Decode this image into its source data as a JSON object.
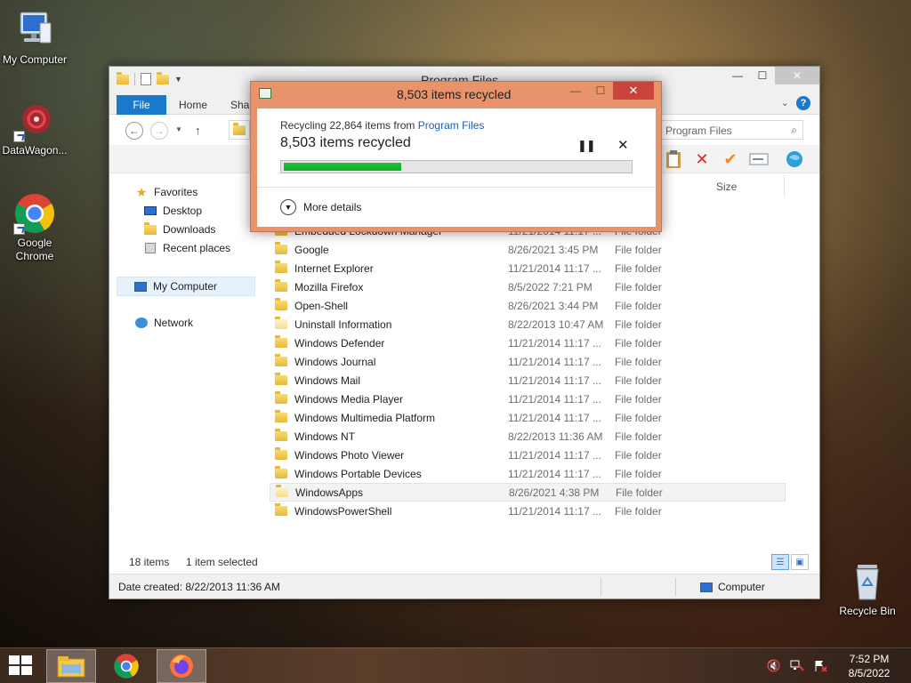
{
  "desktop": {
    "icons": [
      {
        "label": "My Computer"
      },
      {
        "label": "DataWagon..."
      },
      {
        "label": "Google Chrome"
      },
      {
        "label": "Recycle Bin"
      }
    ]
  },
  "explorer": {
    "title": "Program Files",
    "ribbon_tabs": {
      "file": "File",
      "home": "Home",
      "share": "Share"
    },
    "search_placeholder": "Program Files",
    "column_header_size": "Size",
    "nav": {
      "favorites": "Favorites",
      "desktop": "Desktop",
      "downloads": "Downloads",
      "recent": "Recent places",
      "my_computer": "My Computer",
      "network": "Network"
    },
    "files": [
      {
        "name": "Embedded Lockdown Manager",
        "date": "11/21/2014 11:17 ...",
        "type": "File folder"
      },
      {
        "name": "Google",
        "date": "8/26/2021 3:45 PM",
        "type": "File folder"
      },
      {
        "name": "Internet Explorer",
        "date": "11/21/2014 11:17 ...",
        "type": "File folder"
      },
      {
        "name": "Mozilla Firefox",
        "date": "8/5/2022 7:21 PM",
        "type": "File folder"
      },
      {
        "name": "Open-Shell",
        "date": "8/26/2021 3:44 PM",
        "type": "File folder"
      },
      {
        "name": "Uninstall Information",
        "date": "8/22/2013 10:47 AM",
        "type": "File folder"
      },
      {
        "name": "Windows Defender",
        "date": "11/21/2014 11:17 ...",
        "type": "File folder"
      },
      {
        "name": "Windows Journal",
        "date": "11/21/2014 11:17 ...",
        "type": "File folder"
      },
      {
        "name": "Windows Mail",
        "date": "11/21/2014 11:17 ...",
        "type": "File folder"
      },
      {
        "name": "Windows Media Player",
        "date": "11/21/2014 11:17 ...",
        "type": "File folder"
      },
      {
        "name": "Windows Multimedia Platform",
        "date": "11/21/2014 11:17 ...",
        "type": "File folder"
      },
      {
        "name": "Windows NT",
        "date": "8/22/2013 11:36 AM",
        "type": "File folder"
      },
      {
        "name": "Windows Photo Viewer",
        "date": "11/21/2014 11:17 ...",
        "type": "File folder"
      },
      {
        "name": "Windows Portable Devices",
        "date": "11/21/2014 11:17 ...",
        "type": "File folder"
      },
      {
        "name": "WindowsApps",
        "date": "8/26/2021 4:38 PM",
        "type": "File folder"
      },
      {
        "name": "WindowsPowerShell",
        "date": "11/21/2014 11:17 ...",
        "type": "File folder"
      }
    ],
    "status": {
      "items": "18 items",
      "selected": "1 item selected"
    },
    "details": {
      "created": "Date created: 8/22/2013 11:36 AM",
      "location": "Computer"
    }
  },
  "dialog": {
    "title": "8,503 items recycled",
    "line1_prefix": "Recycling 22,864 items from ",
    "line1_link": "Program Files",
    "status": "8,503 items recycled",
    "progress": 0.34,
    "more_details": "More details"
  },
  "taskbar": {
    "time": "7:52 PM",
    "date": "8/5/2022"
  },
  "colors": {
    "accent": "#1979ca",
    "dialog_frame": "#e8936b",
    "progress_fill": "#0eaa2a",
    "close_red": "#c9443b"
  }
}
